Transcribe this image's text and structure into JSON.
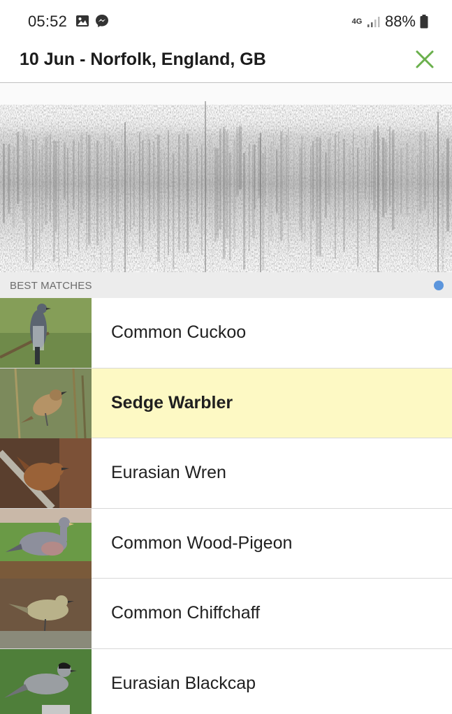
{
  "status_bar": {
    "time": "05:52",
    "network": "4G",
    "battery": "88%"
  },
  "header": {
    "title": "10 Jun - Norfolk, England, GB",
    "close_icon": "close-x-icon",
    "accent_color": "#6ab04c"
  },
  "section": {
    "label": "BEST MATCHES"
  },
  "results": [
    {
      "name": "Common Cuckoo",
      "selected": false
    },
    {
      "name": "Sedge Warbler",
      "selected": true
    },
    {
      "name": "Eurasian Wren",
      "selected": false
    },
    {
      "name": "Common Wood-Pigeon",
      "selected": false
    },
    {
      "name": "Common Chiffchaff",
      "selected": false
    },
    {
      "name": "Eurasian Blackcap",
      "selected": false
    }
  ]
}
